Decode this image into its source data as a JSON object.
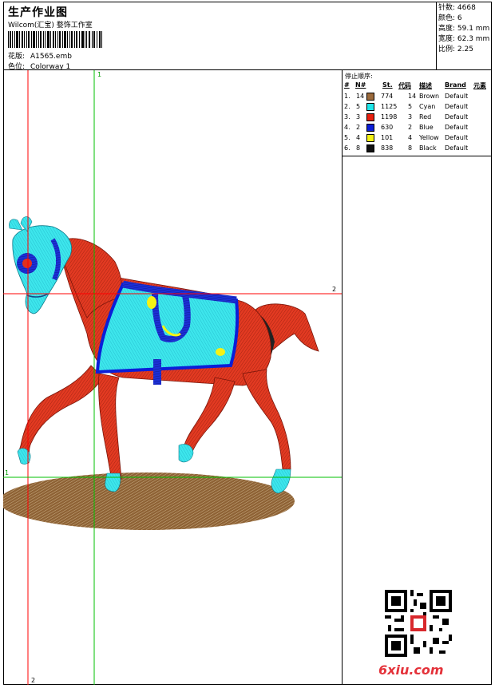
{
  "header": {
    "title": "生产作业图",
    "studio": "Wilcom(汇宝) 婺饰工作室",
    "design_label": "花版:",
    "design_value": "A1565.emb",
    "colorway_label": "色位:",
    "colorway_value": "Colorway 1"
  },
  "stats": {
    "stitches": "针数: 4668",
    "colors": "颜色: 6",
    "height": "高度: 59.1 mm",
    "width": "宽度: 62.3 mm",
    "scale": "比例: 2.25"
  },
  "stop_sequence": {
    "title": "停止顺序:",
    "headers": {
      "index": "#",
      "n": "N#",
      "st": "St.",
      "code": "代码",
      "desc": "描述",
      "brand": "Brand",
      "elem": "元素"
    },
    "rows": [
      {
        "index": "1.",
        "n": "14",
        "color": "#9b6a3c",
        "st": "774",
        "code": "14",
        "desc": "Brown",
        "brand": "Default"
      },
      {
        "index": "2.",
        "n": "5",
        "color": "#1fe6ea",
        "st": "1125",
        "code": "5",
        "desc": "Cyan",
        "brand": "Default"
      },
      {
        "index": "3.",
        "n": "3",
        "color": "#e8200f",
        "st": "1198",
        "code": "3",
        "desc": "Red",
        "brand": "Default"
      },
      {
        "index": "4.",
        "n": "2",
        "color": "#0b1ed8",
        "st": "630",
        "code": "2",
        "desc": "Blue",
        "brand": "Default"
      },
      {
        "index": "5.",
        "n": "4",
        "color": "#f4f214",
        "st": "101",
        "code": "4",
        "desc": "Yellow",
        "brand": "Default"
      },
      {
        "index": "6.",
        "n": "8",
        "color": "#111111",
        "st": "838",
        "code": "8",
        "desc": "Black",
        "brand": "Default"
      }
    ]
  },
  "guides": {
    "v1": "1",
    "v2": "2",
    "h1": "1",
    "h2": "2"
  },
  "footer": {
    "brand": "6xiu.com"
  },
  "colors": {
    "red": "#e0301e",
    "cyan": "#2ce3e8",
    "blue": "#1a2bd8",
    "brown": "#9c6b3a",
    "green_guide": "#00c000",
    "red_guide": "#ff0000"
  }
}
